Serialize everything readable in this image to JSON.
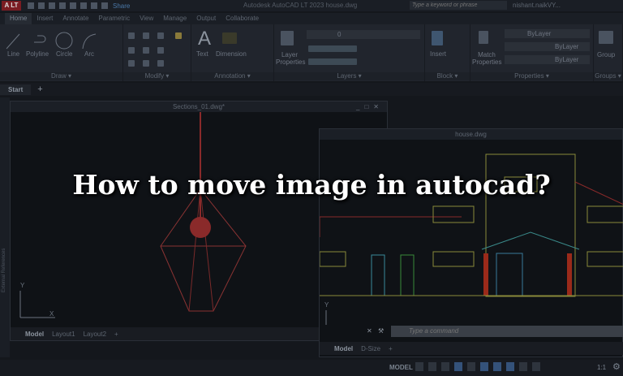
{
  "titlebar": {
    "logo": "A LT",
    "share": "Share",
    "title": "Autodesk AutoCAD LT 2023   house.dwg",
    "search_placeholder": "Type a keyword or phrase",
    "user": "nishant.naikVY..."
  },
  "ribbon_tabs": [
    "Home",
    "Insert",
    "Annotate",
    "Parametric",
    "View",
    "Manage",
    "Output",
    "Collaborate"
  ],
  "panels": {
    "draw": {
      "label": "Draw ▾",
      "tools": [
        "Line",
        "Polyline",
        "Circle",
        "Arc"
      ]
    },
    "modify": {
      "label": "Modify ▾"
    },
    "annotation": {
      "label": "Annotation ▾",
      "tools": [
        "Text",
        "Dimension"
      ]
    },
    "layers": {
      "label": "Layers ▾",
      "tool": "Layer Properties",
      "layer_value": "0"
    },
    "block": {
      "label": "Block ▾",
      "tool": "Insert"
    },
    "properties": {
      "label": "Properties ▾",
      "tool": "Match Properties",
      "color": "ByLayer",
      "linetype": "ByLayer",
      "lineweight": "ByLayer"
    },
    "groups": {
      "label": "Groups ▾",
      "tool": "Group"
    }
  },
  "file_tabs": {
    "start": "Start",
    "add": "+"
  },
  "left_window": {
    "title": "Sections_01.dwg*",
    "tabs": [
      "Model",
      "Layout1",
      "Layout2"
    ],
    "add": "+",
    "side_label": "External References",
    "ucs_y": "Y",
    "ucs_x": "X"
  },
  "right_window": {
    "title": "house.dwg",
    "tabs": [
      "Model",
      "D-Size"
    ],
    "add": "+",
    "ucs_y": "Y"
  },
  "command": {
    "placeholder": "Type a command"
  },
  "status": {
    "model": "MODEL",
    "scale": "1:1"
  },
  "headline": "How to move image in autocad?"
}
